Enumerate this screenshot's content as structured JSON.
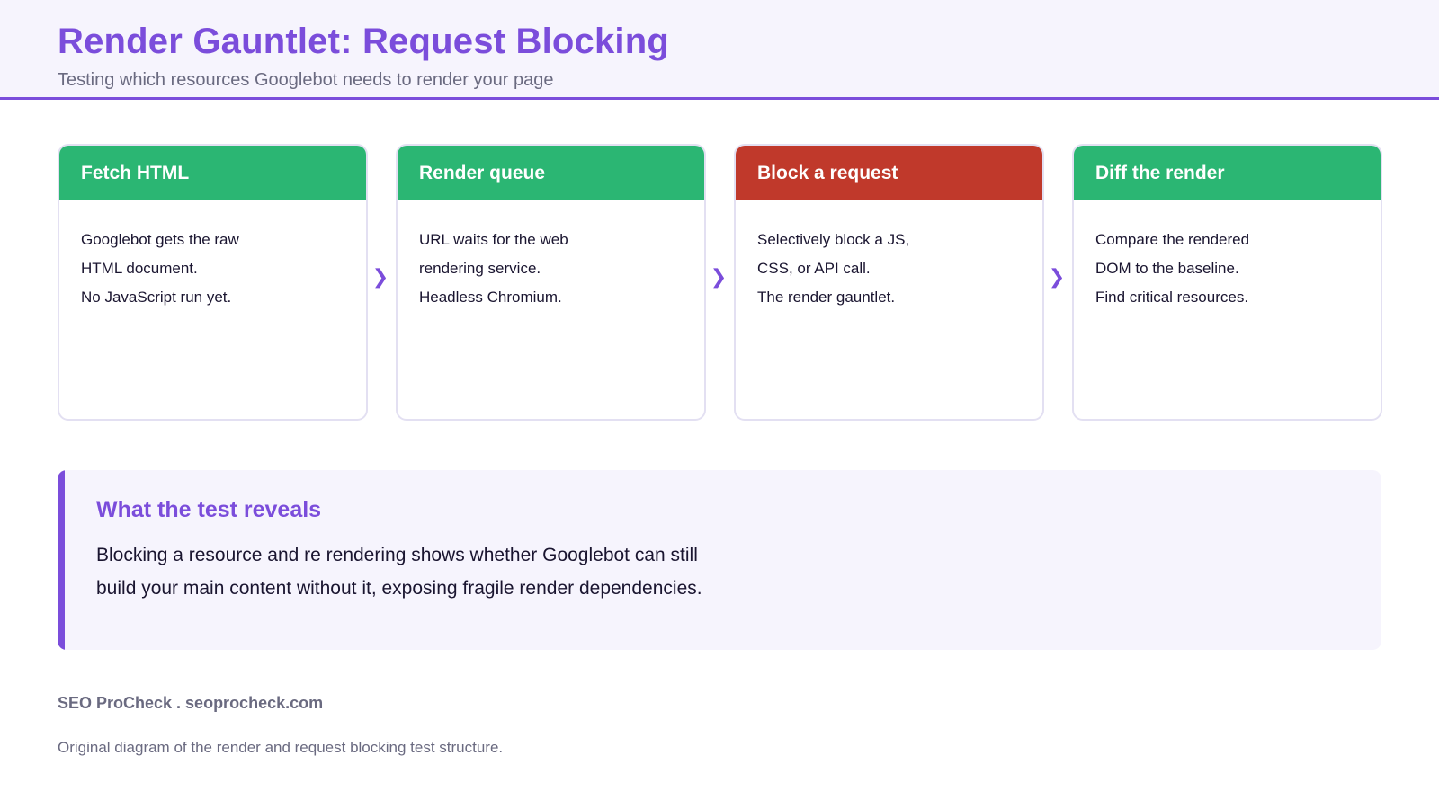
{
  "header": {
    "title": "Render Gauntlet: Request Blocking",
    "subtitle": "Testing which resources Googlebot needs to render your page"
  },
  "steps": [
    {
      "title": "Fetch HTML",
      "status": "normal",
      "lines": [
        "Googlebot gets the raw",
        "HTML document.",
        "No JavaScript run yet."
      ]
    },
    {
      "title": "Render queue",
      "status": "normal",
      "lines": [
        "URL waits for the web",
        "rendering service.",
        "Headless Chromium."
      ]
    },
    {
      "title": "Block a request",
      "status": "highlight",
      "lines": [
        "Selectively block a JS,",
        "CSS, or API call.",
        "The render gauntlet."
      ]
    },
    {
      "title": "Diff the render",
      "status": "normal",
      "lines": [
        "Compare the rendered",
        "DOM to the baseline.",
        "Find critical resources."
      ]
    }
  ],
  "arrow_glyph": "❯",
  "callout": {
    "title": "What the test reveals",
    "lines": [
      "Blocking a resource and re rendering shows whether Googlebot can still",
      "build your main content without it, exposing fragile render dependencies."
    ]
  },
  "footer": {
    "brand": "SEO ProCheck . seoprocheck.com",
    "caption": "Original diagram of the render and request blocking test structure."
  },
  "colors": {
    "accent": "#7b4ddb",
    "step_normal": "#2bb673",
    "step_highlight": "#c0392b"
  }
}
